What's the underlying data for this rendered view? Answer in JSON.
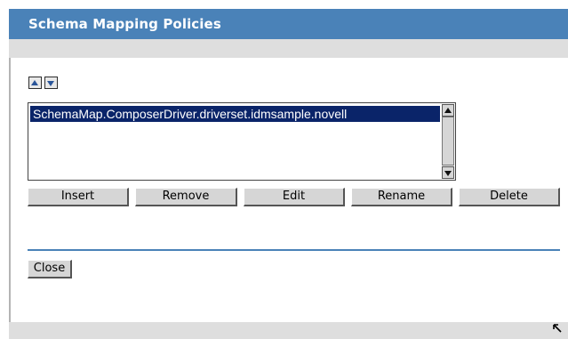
{
  "title": "Schema Mapping Policies",
  "list_items": [
    "SchemaMap.ComposerDriver.driverset.idmsample.novell"
  ],
  "buttons": {
    "insert": "Insert",
    "remove": "Remove",
    "edit": "Edit",
    "rename": "Rename",
    "delete": "Delete",
    "close": "Close"
  },
  "icons": {
    "move_up": "arrow-up-icon",
    "move_down": "arrow-down-icon",
    "resize": "resize-grip-icon"
  },
  "colors": {
    "title_bar": "#4a82b8",
    "selection": "#0a2469",
    "button_face": "#d6d6d6"
  }
}
